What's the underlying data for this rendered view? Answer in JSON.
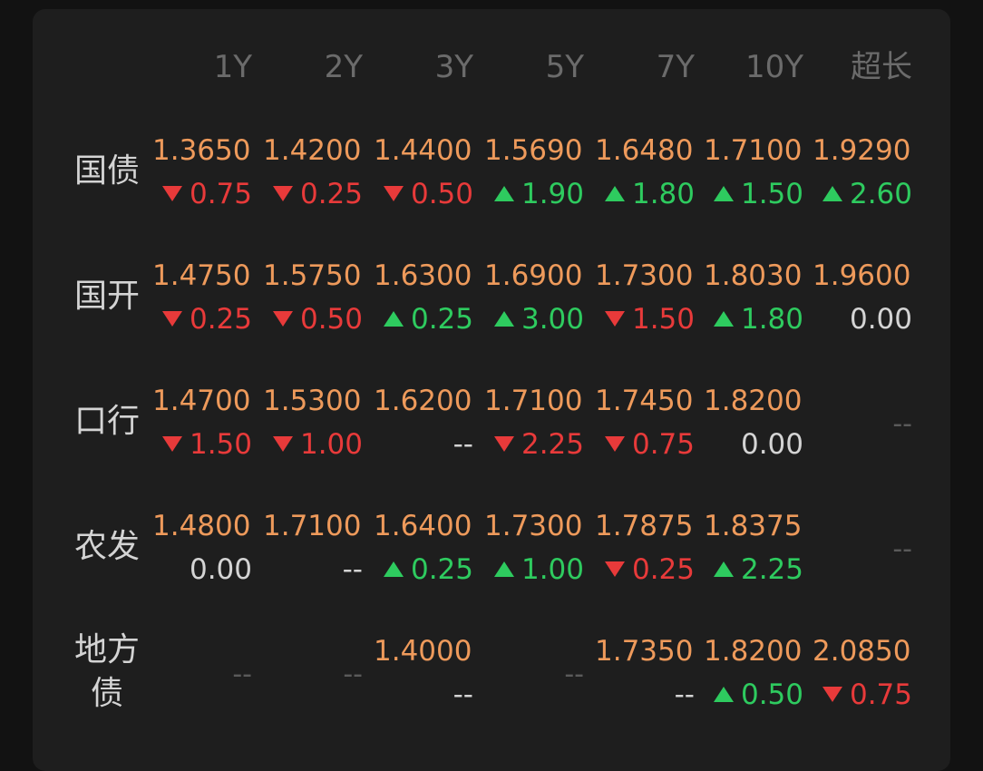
{
  "columns": [
    "1Y",
    "2Y",
    "3Y",
    "5Y",
    "7Y",
    "10Y",
    "超长"
  ],
  "rows": [
    {
      "label": "国债",
      "cells": [
        {
          "yield": "1.3650",
          "dir": "down",
          "chg": "0.75"
        },
        {
          "yield": "1.4200",
          "dir": "down",
          "chg": "0.25"
        },
        {
          "yield": "1.4400",
          "dir": "down",
          "chg": "0.50"
        },
        {
          "yield": "1.5690",
          "dir": "up",
          "chg": "1.90"
        },
        {
          "yield": "1.6480",
          "dir": "up",
          "chg": "1.80"
        },
        {
          "yield": "1.7100",
          "dir": "up",
          "chg": "1.50"
        },
        {
          "yield": "1.9290",
          "dir": "up",
          "chg": "2.60"
        }
      ]
    },
    {
      "label": "国开",
      "cells": [
        {
          "yield": "1.4750",
          "dir": "down",
          "chg": "0.25"
        },
        {
          "yield": "1.5750",
          "dir": "down",
          "chg": "0.50"
        },
        {
          "yield": "1.6300",
          "dir": "up",
          "chg": "0.25"
        },
        {
          "yield": "1.6900",
          "dir": "up",
          "chg": "3.00"
        },
        {
          "yield": "1.7300",
          "dir": "down",
          "chg": "1.50"
        },
        {
          "yield": "1.8030",
          "dir": "up",
          "chg": "1.80"
        },
        {
          "yield": "1.9600",
          "dir": "flat",
          "chg": "0.00"
        }
      ]
    },
    {
      "label": "口行",
      "cells": [
        {
          "yield": "1.4700",
          "dir": "down",
          "chg": "1.50"
        },
        {
          "yield": "1.5300",
          "dir": "down",
          "chg": "1.00"
        },
        {
          "yield": "1.6200",
          "dir": "none",
          "chg": "--"
        },
        {
          "yield": "1.7100",
          "dir": "down",
          "chg": "2.25"
        },
        {
          "yield": "1.7450",
          "dir": "down",
          "chg": "0.75"
        },
        {
          "yield": "1.8200",
          "dir": "flat",
          "chg": "0.00"
        },
        {
          "empty": "--"
        }
      ]
    },
    {
      "label": "农发",
      "cells": [
        {
          "yield": "1.4800",
          "dir": "flat",
          "chg": "0.00"
        },
        {
          "yield": "1.7100",
          "dir": "none",
          "chg": "--"
        },
        {
          "yield": "1.6400",
          "dir": "up",
          "chg": "0.25"
        },
        {
          "yield": "1.7300",
          "dir": "up",
          "chg": "1.00"
        },
        {
          "yield": "1.7875",
          "dir": "down",
          "chg": "0.25"
        },
        {
          "yield": "1.8375",
          "dir": "up",
          "chg": "2.25"
        },
        {
          "empty": "--"
        }
      ]
    },
    {
      "label": "地方债",
      "cells": [
        {
          "empty": "--"
        },
        {
          "empty": "--"
        },
        {
          "yield": "1.4000",
          "dir": "none",
          "chg": "--"
        },
        {
          "empty": "--"
        },
        {
          "yield": "1.7350",
          "dir": "none",
          "chg": "--"
        },
        {
          "yield": "1.8200",
          "dir": "up",
          "chg": "0.50"
        },
        {
          "yield": "2.0850",
          "dir": "down",
          "chg": "0.75"
        }
      ]
    }
  ]
}
